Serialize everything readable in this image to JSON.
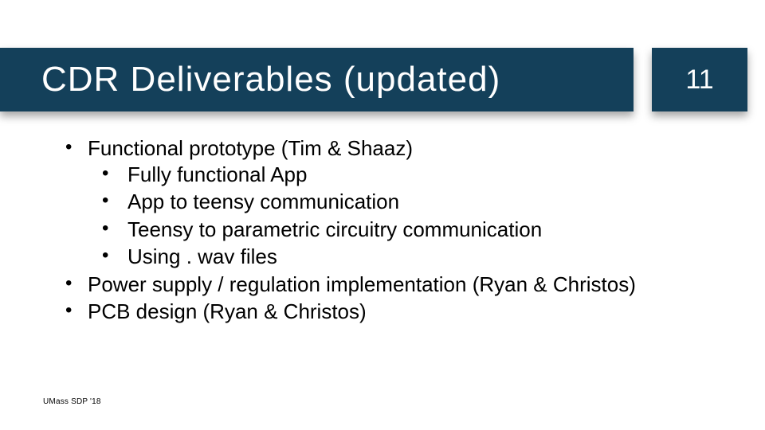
{
  "header": {
    "title": "CDR Deliverables (updated)",
    "page_number": "11"
  },
  "bullets": [
    {
      "text": "Functional prototype (Tim & Shaaz)",
      "sub": [
        "Fully functional App",
        "App to teensy communication",
        "Teensy to parametric circuitry communication",
        "Using . wav files"
      ]
    },
    {
      "text": "Power supply / regulation implementation (Ryan & Christos)",
      "sub": []
    },
    {
      "text": "PCB design (Ryan & Christos)",
      "sub": []
    }
  ],
  "footer": "UMass SDP '18"
}
